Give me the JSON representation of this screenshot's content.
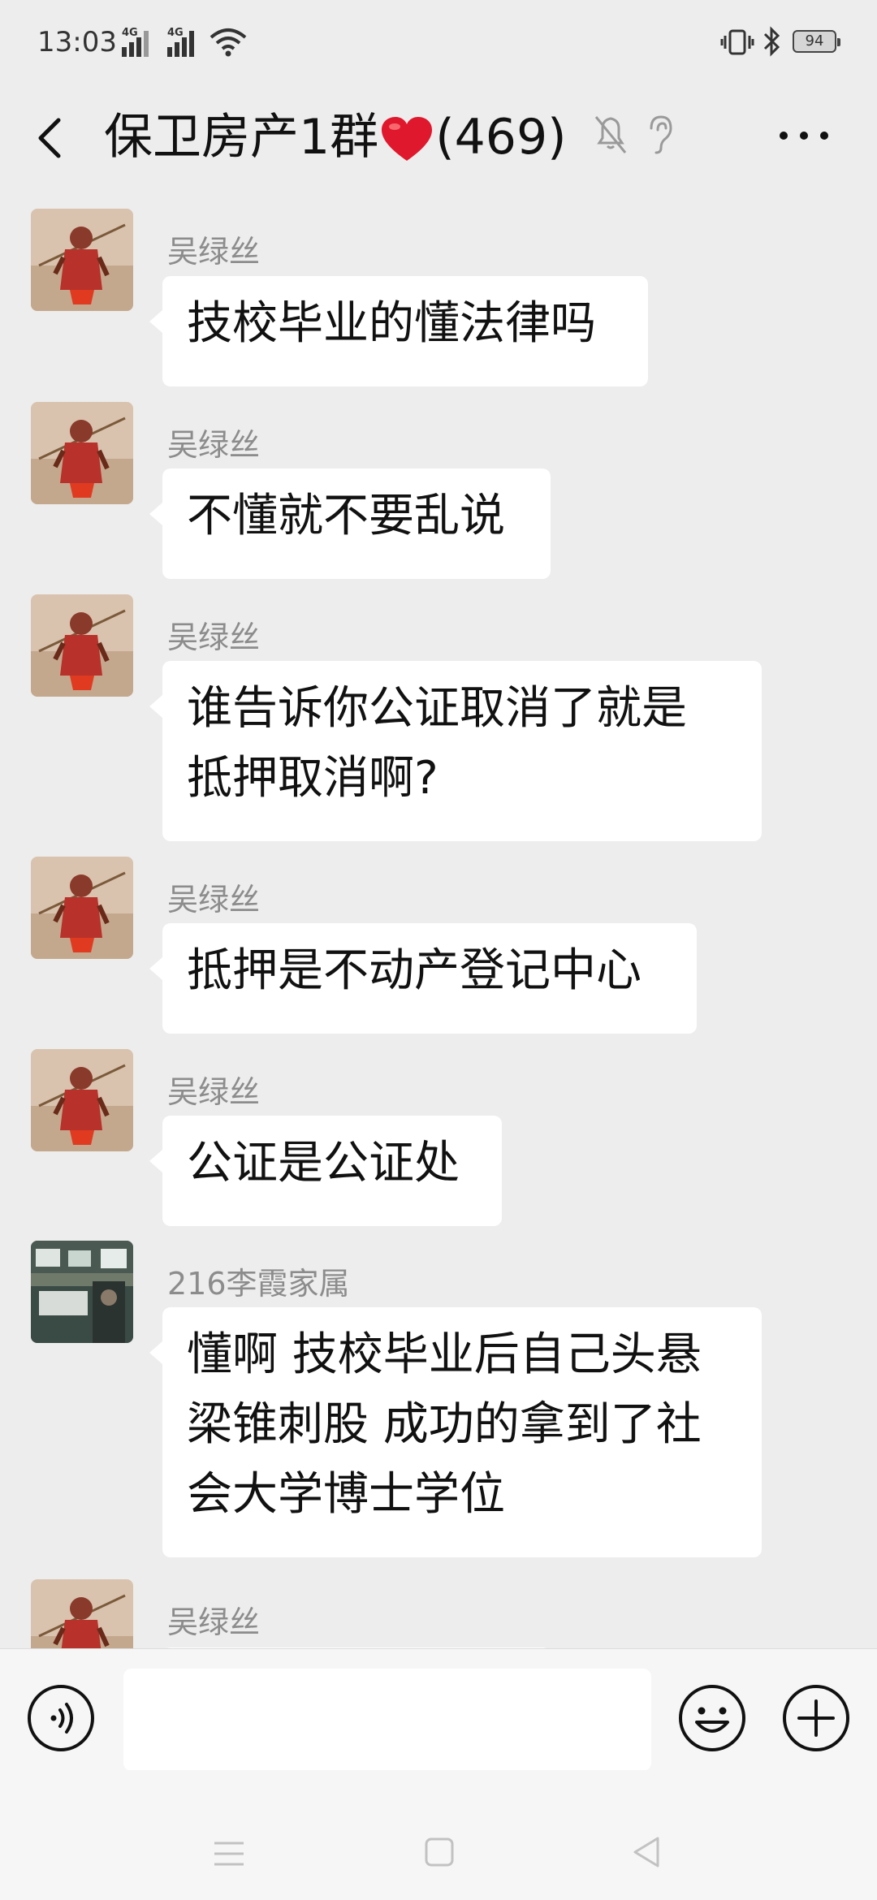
{
  "status_bar": {
    "time": "13:03",
    "sim1_label": "4G",
    "sim2_label": "4G",
    "battery": "94"
  },
  "header": {
    "title_prefix": "保卫房产1群",
    "title_suffix": "(469)"
  },
  "messages": [
    {
      "sender": "吴绿丝",
      "lines": [
        "技校毕业的懂法律吗"
      ]
    },
    {
      "sender": "吴绿丝",
      "lines": [
        "不懂就不要乱说"
      ]
    },
    {
      "sender": "吴绿丝",
      "lines": [
        "谁告诉你公证取消了就是",
        "抵押取消啊?"
      ]
    },
    {
      "sender": "吴绿丝",
      "lines": [
        "抵押是不动产登记中心"
      ]
    },
    {
      "sender": "吴绿丝",
      "lines": [
        "公证是公证处"
      ]
    },
    {
      "sender": "216李霞家属",
      "lines": [
        "懂啊 技校毕业后自己头悬",
        "梁锥刺股 成功的拿到了社",
        "会大学博士学位"
      ]
    },
    {
      "sender": "吴绿丝",
      "lines": [
        ""
      ]
    }
  ],
  "input": {
    "value": "",
    "placeholder": ""
  },
  "icons": {
    "back": "chevron-left-icon",
    "mute": "bell-off-icon",
    "earpiece": "ear-icon",
    "more": "more-horizontal-icon",
    "voice": "voice-icon",
    "emoji": "smiley-icon",
    "plus": "plus-circle-icon"
  },
  "colors": {
    "background": "#ededed",
    "bubble": "#ffffff",
    "sender_name": "#8c8c8c",
    "heart": "#e0182d"
  }
}
